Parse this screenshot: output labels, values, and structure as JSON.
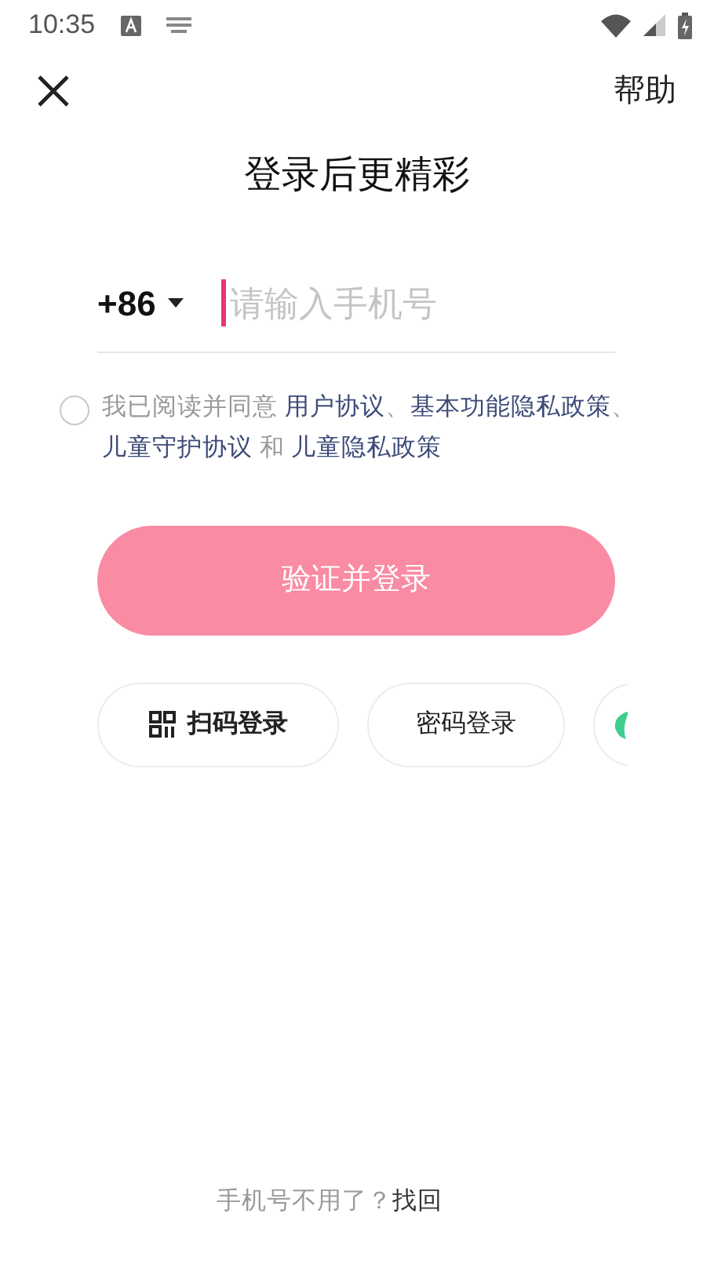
{
  "status_bar": {
    "time": "10:35"
  },
  "header": {
    "help": "帮助"
  },
  "title": "登录后更精彩",
  "phone": {
    "country_code": "+86",
    "placeholder": "请输入手机号"
  },
  "agreement": {
    "checked": false,
    "segments": [
      {
        "kind": "text",
        "text": "我已阅读并同意 "
      },
      {
        "kind": "link",
        "text": "用户协议"
      },
      {
        "kind": "text",
        "text": "、"
      },
      {
        "kind": "link",
        "text": "基本功能隐私政策"
      },
      {
        "kind": "text",
        "text": "、"
      },
      {
        "kind": "link",
        "text": "儿童守护协议"
      },
      {
        "kind": "text",
        "text": " 和 "
      },
      {
        "kind": "link",
        "text": "儿童隐私政策"
      }
    ]
  },
  "submit": {
    "label": "验证并登录",
    "disabled": true
  },
  "login_options": [
    {
      "kind": "qr",
      "label": "扫码登录"
    },
    {
      "kind": "plain",
      "label": "密码登录"
    },
    {
      "kind": "app"
    }
  ],
  "footer": {
    "text": "手机号不用了？",
    "link": "找回"
  }
}
